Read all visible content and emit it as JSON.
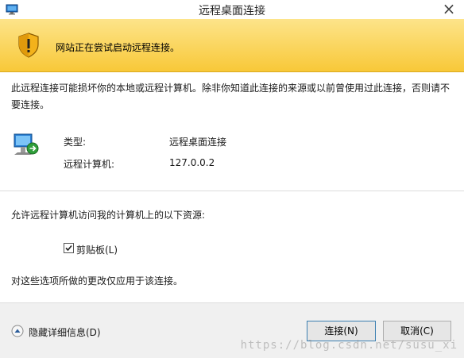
{
  "window": {
    "title": "远程桌面连接",
    "close_glyph": "×"
  },
  "banner": {
    "message": "网站正在尝试启动远程连接。"
  },
  "description": "此远程连接可能损坏你的本地或远程计算机。除非你知道此连接的来源或以前曾使用过此连接，否则请不要连接。",
  "connection_info": {
    "type_label": "类型:",
    "type_value": "远程桌面连接",
    "computer_label": "远程计算机:",
    "computer_value": "127.0.0.2"
  },
  "resources": {
    "prompt": "允许远程计算机访问我的计算机上的以下资源:",
    "clipboard_label": "剪贴板(L)",
    "clipboard_checked": true,
    "note": "对这些选项所做的更改仅应用于该连接。"
  },
  "footer": {
    "details_toggle_label": "隐藏详细信息(D)",
    "connect_label": "连接(N)",
    "cancel_label": "取消(C)"
  },
  "watermark": "https://blog.csdn.net/susu_xi",
  "colors": {
    "banner_top": "#fde48a",
    "banner_bottom": "#f8c838",
    "button_focus_border": "#3c7fb1"
  },
  "icons": {
    "app": "remote-desktop-icon",
    "banner": "warning-shield-icon",
    "connection": "remote-monitor-icon",
    "toggle": "chevron-up-icon"
  }
}
